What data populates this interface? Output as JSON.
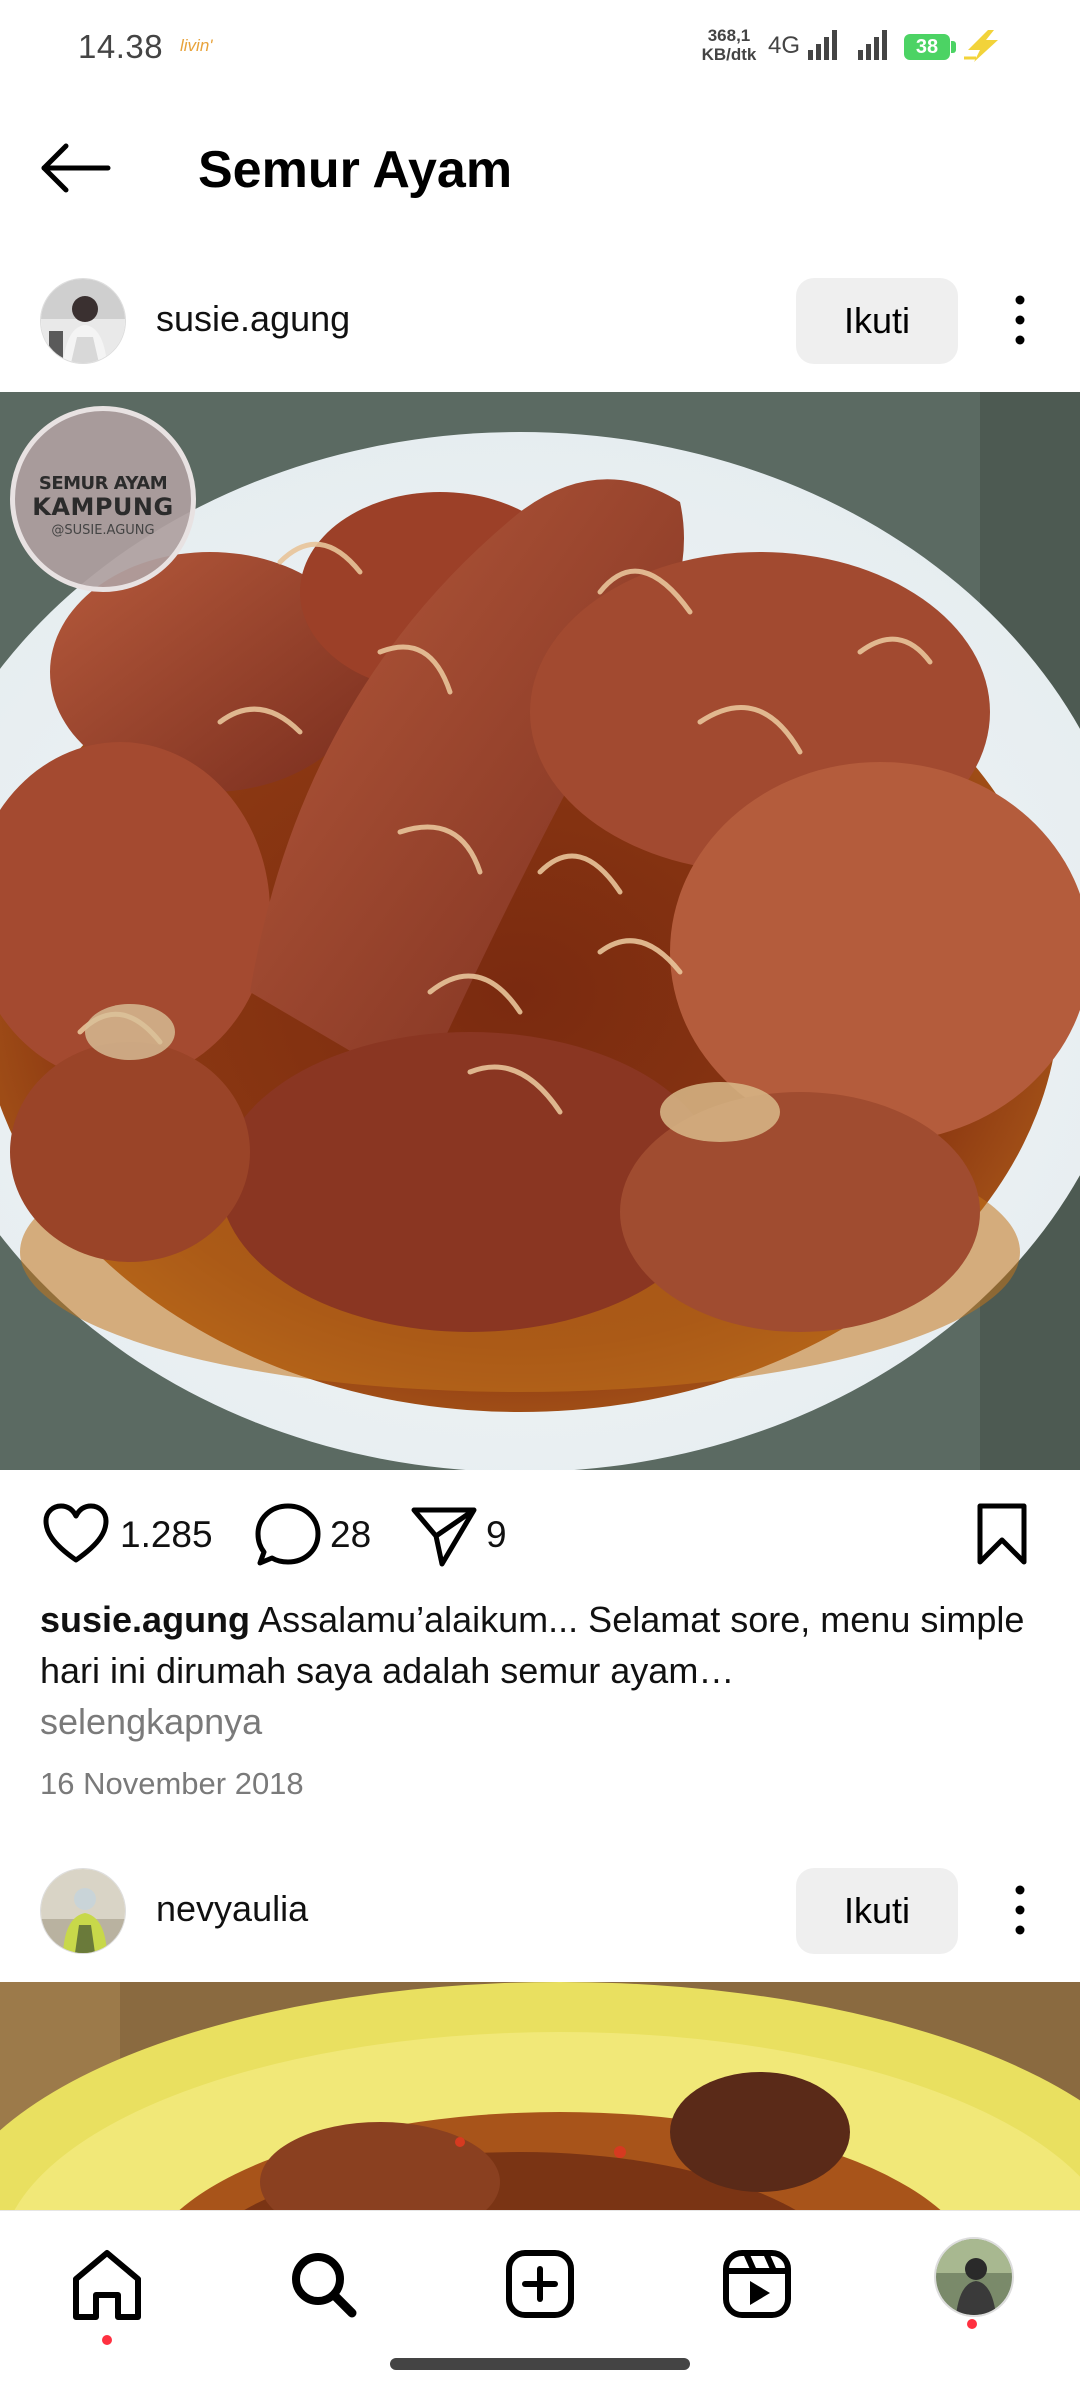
{
  "status_bar": {
    "time": "14.38",
    "carrier_logo": "livin'",
    "speed_value": "368,1",
    "speed_unit": "KB/dtk",
    "network": "4G",
    "battery": "38",
    "icons": [
      "signal-icon",
      "signal-icon",
      "battery-icon",
      "charging-icon"
    ]
  },
  "header": {
    "title": "Semur Ayam",
    "back_icon": "back-arrow-icon"
  },
  "posts": [
    {
      "username": "susie.agung",
      "follow_label": "Ikuti",
      "watermark": {
        "line1": "SEMUR AYAM",
        "line2": "KAMPUNG",
        "line3": "@SUSIE.AGUNG"
      },
      "likes": "1.285",
      "comments": "28",
      "shares": "9",
      "caption": "Assalamu’alaikum... Selamat sore, menu simple hari ini dirumah saya adalah semur ayam…",
      "more_label": "selengkapnya",
      "date": "16 November 2018"
    },
    {
      "username": "nevyaulia",
      "follow_label": "Ikuti"
    }
  ],
  "bottom_nav": {
    "items": [
      "home-icon",
      "search-icon",
      "create-icon",
      "reels-icon",
      "profile-avatar"
    ]
  },
  "colors": {
    "follow_bg": "#efefef",
    "notification": "#ff3040",
    "battery": "#4cd364",
    "secondary_text": "#7a7a7a"
  }
}
